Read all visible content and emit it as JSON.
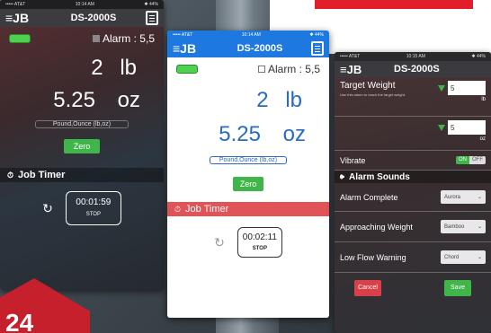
{
  "common": {
    "carrier": "••••• AT&T",
    "brand": "≡JB",
    "model": "DS-2000S"
  },
  "phone1": {
    "time": "10:14 AM",
    "battery_status": "✱ 44%",
    "alarm_label": "Alarm : 5,5",
    "pounds": "2",
    "pounds_unit": "lb",
    "ounces": "5.25",
    "ounces_unit": "oz",
    "unit_select": "Pound,Ounce (lb,oz)",
    "zero_label": "Zero",
    "timer_title": "Job Timer",
    "timer_value": "00:01:59",
    "timer_button": "STOP"
  },
  "phone2": {
    "time": "10:14 AM",
    "battery_status": "✱ 44%",
    "alarm_label": "Alarm : 5,5",
    "pounds": "2",
    "pounds_unit": "lb",
    "ounces": "5.25",
    "ounces_unit": "oz",
    "unit_select": "Pound,Ounce (lb,oz)",
    "zero_label": "Zero",
    "timer_title": "Job Timer",
    "timer_value": "00:02:11",
    "timer_button": "STOP"
  },
  "phone3": {
    "time": "10:15 AM",
    "battery_status": "✱ 44%",
    "target_label": "Target Weight",
    "target_help": "Use this alarm to reach the target weight.",
    "target_lb_value": "5",
    "target_lb_unit": "lb",
    "target_oz_value": "5",
    "target_oz_unit": "oz",
    "vibrate_label": "Vibrate",
    "toggle_on": "ON",
    "toggle_off": "OFF",
    "alarm_sounds_title": "Alarm Sounds",
    "alarm_complete_label": "Alarm Complete",
    "alarm_complete_value": "Aurora",
    "approaching_label": "Approaching Weight",
    "approaching_value": "Bamboo",
    "low_flow_label": "Low Flow Warning",
    "low_flow_value": "Chord",
    "cancel_label": "Cancel",
    "save_label": "Save"
  },
  "page_number": "24",
  "colors": {
    "accent_green": "#40b64a",
    "ios_blue": "#1d78e0",
    "timer_red": "#e05356",
    "brand_red": "#e21e2b"
  }
}
